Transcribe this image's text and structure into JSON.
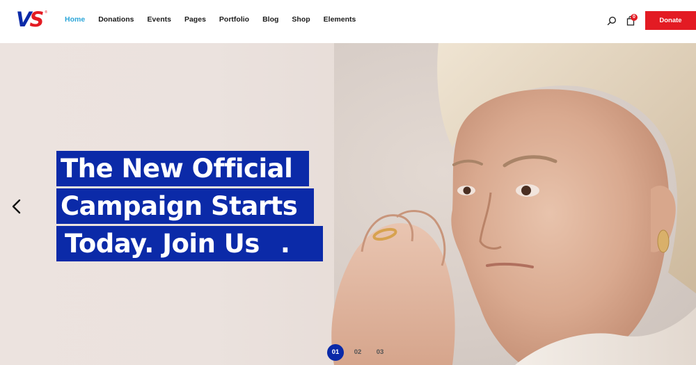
{
  "brand": {
    "logo_v": "V",
    "logo_s": "S",
    "logo_mark": "®",
    "primary_color": "#0b2aa8",
    "accent_color": "#e31b23",
    "nav_active_color": "#2ca6d9"
  },
  "nav": {
    "items": [
      {
        "label": "Home",
        "active": true
      },
      {
        "label": "Donations",
        "active": false
      },
      {
        "label": "Events",
        "active": false
      },
      {
        "label": "Pages",
        "active": false
      },
      {
        "label": "Portfolio",
        "active": false
      },
      {
        "label": "Blog",
        "active": false
      },
      {
        "label": "Shop",
        "active": false
      },
      {
        "label": "Elements",
        "active": false
      }
    ]
  },
  "header": {
    "search_icon": "search-icon",
    "cart_icon": "shopping-bag-icon",
    "cart_count": "0",
    "donate_label": "Donate"
  },
  "hero": {
    "headline_lines": [
      "The New Official",
      "Campaign Starts",
      "Today. Join Us"
    ],
    "headline_end_dot": ".",
    "prev_icon": "chevron-left-icon",
    "image": "woman-portrait-photo",
    "slides": [
      {
        "label": "01",
        "active": true
      },
      {
        "label": "02",
        "active": false
      },
      {
        "label": "03",
        "active": false
      }
    ]
  }
}
